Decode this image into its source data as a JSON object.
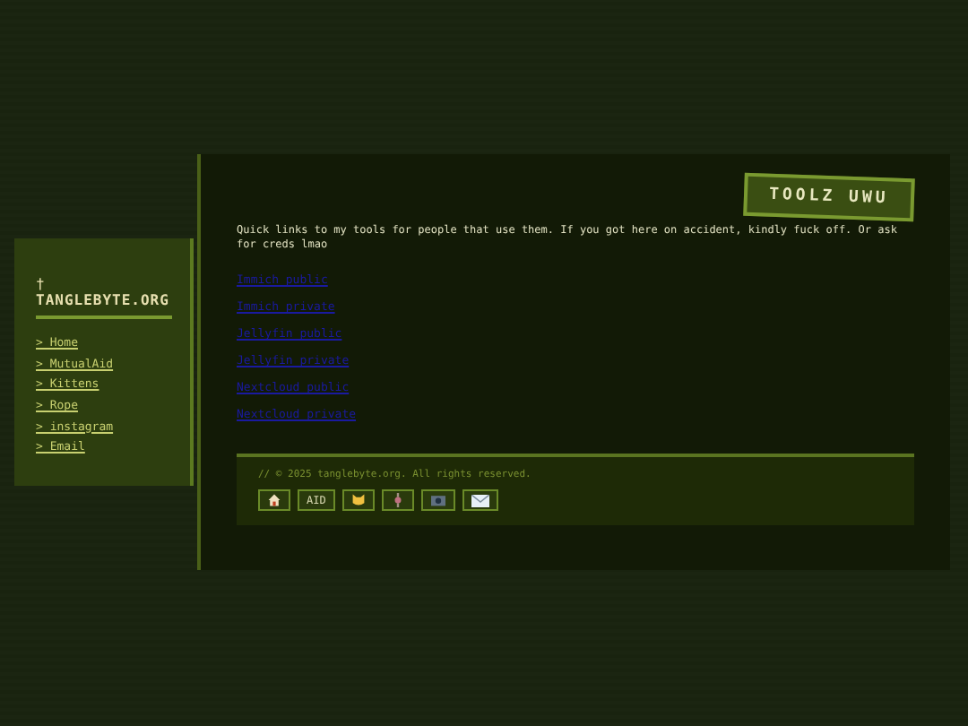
{
  "sidebar": {
    "mark": "†",
    "title": "TANGLEBYTE.ORG",
    "items": [
      {
        "label": "> Home"
      },
      {
        "label": "> MutualAid"
      },
      {
        "label": "> Kittens"
      },
      {
        "label": "> Rope"
      },
      {
        "label": "> instagram"
      },
      {
        "label": "> Email"
      }
    ]
  },
  "badge": "TOOLZ UWU",
  "intro": "Quick links to my tools for people that use them. If you got here on accident, kindly fuck off. Or ask for creds lmao",
  "links": [
    {
      "label": "Immich public"
    },
    {
      "label": "Immich private"
    },
    {
      "label": "Jellyfin public"
    },
    {
      "label": "Jellyfin private"
    },
    {
      "label": "Nextcloud public"
    },
    {
      "label": "Nextcloud private"
    }
  ],
  "footer": {
    "copyright": "// © 2025 tanglebyte.org. All rights reserved.",
    "buttons": [
      {
        "kind": "house"
      },
      {
        "kind": "text",
        "label": "AID"
      },
      {
        "kind": "cat"
      },
      {
        "kind": "rope"
      },
      {
        "kind": "camera"
      },
      {
        "kind": "mail"
      }
    ]
  }
}
